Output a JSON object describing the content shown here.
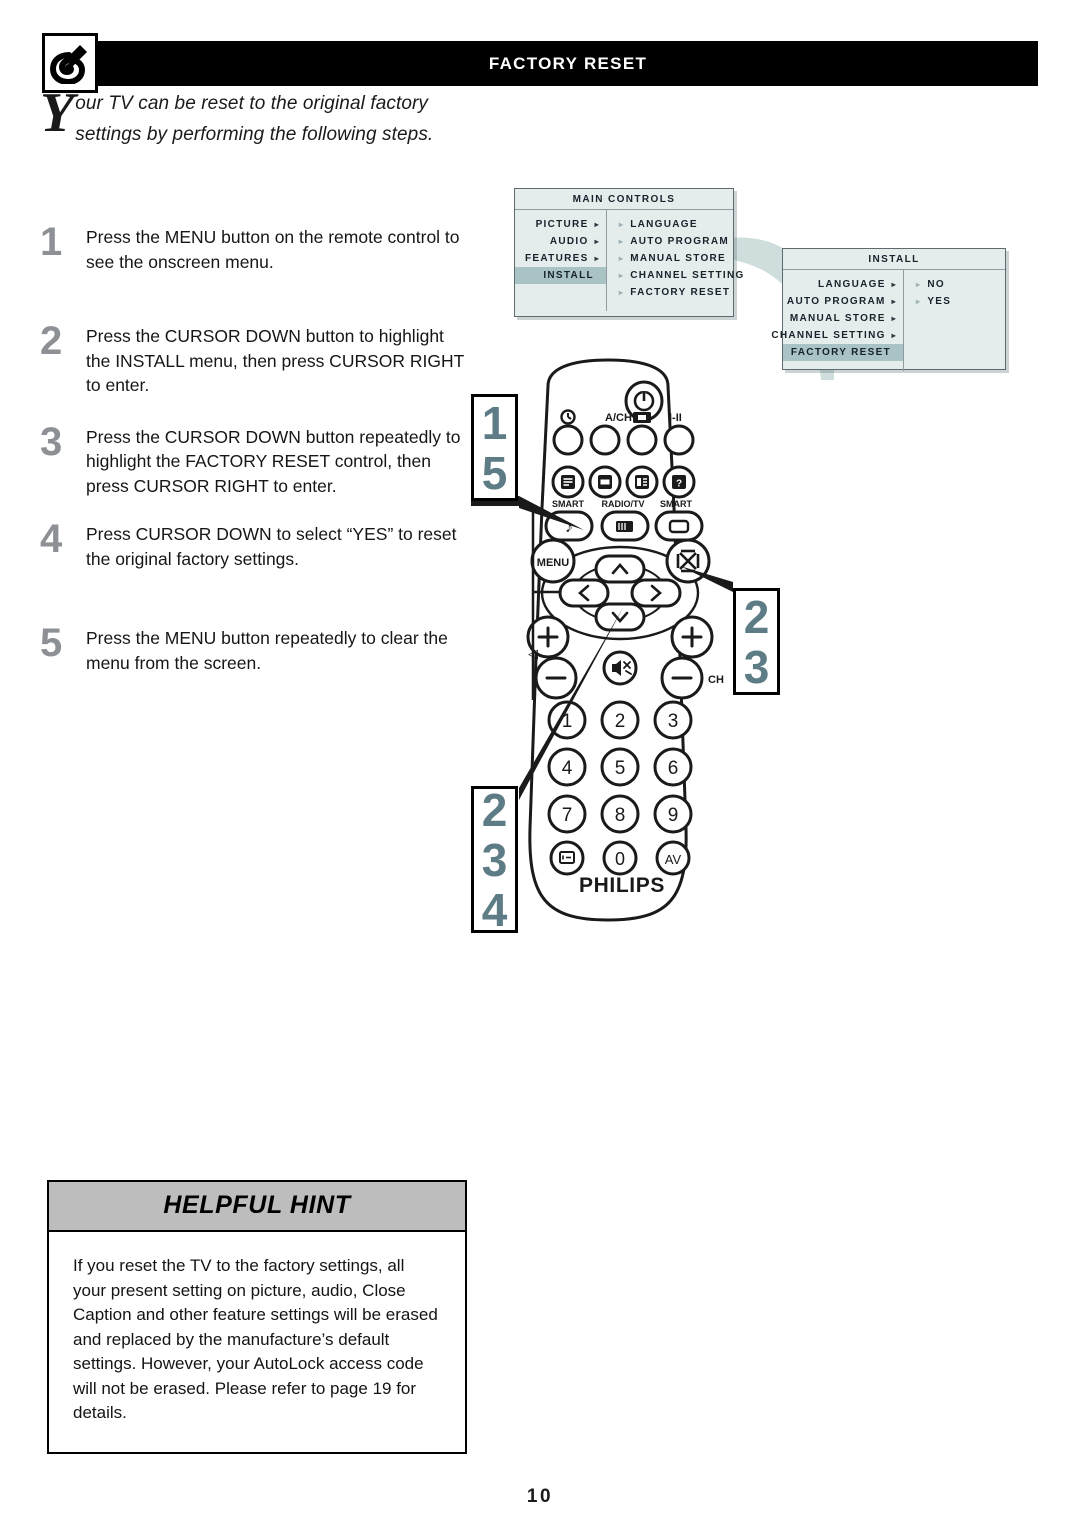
{
  "header": {
    "title": "FACTORY RESET",
    "logo_icon": "philips-shield-logo-icon"
  },
  "intro": {
    "dropcap": "Y",
    "text": "our TV can be reset to the original factory settings by performing the following steps."
  },
  "steps": [
    {
      "number": "1",
      "text": "Press the MENU button on the remote control to see the onscreen menu."
    },
    {
      "number": "2",
      "text": "Press the CURSOR DOWN button to highlight the INSTALL menu, then press CURSOR RIGHT to enter."
    },
    {
      "number": "3",
      "text": "Press the CURSOR DOWN button repeatedly to highlight the FACTORY RESET control, then press CURSOR RIGHT to enter."
    },
    {
      "number": "4",
      "text": "Press CURSOR DOWN to select “YES” to reset the original factory settings."
    },
    {
      "number": "5",
      "text": "Press the MENU button repeatedly to clear the menu from the screen."
    }
  ],
  "osd_main": {
    "title": "MAIN CONTROLS",
    "left_items": [
      {
        "label": "PICTURE",
        "arrow": "▸",
        "selected": false
      },
      {
        "label": "AUDIO",
        "arrow": "▸",
        "selected": false
      },
      {
        "label": "FEATURES",
        "arrow": "▸",
        "selected": false
      },
      {
        "label": "INSTALL",
        "arrow": "",
        "selected": true
      }
    ],
    "right_items": [
      {
        "label": "LANGUAGE",
        "bullet": "▸"
      },
      {
        "label": "AUTO PROGRAM",
        "bullet": "▸"
      },
      {
        "label": "MANUAL STORE",
        "bullet": "▸"
      },
      {
        "label": "CHANNEL SETTING",
        "bullet": "▸"
      },
      {
        "label": "FACTORY RESET",
        "bullet": "▸"
      }
    ]
  },
  "osd_install": {
    "title": "INSTALL",
    "left_items": [
      {
        "label": "LANGUAGE",
        "arrow": "▸",
        "selected": false
      },
      {
        "label": "AUTO PROGRAM",
        "arrow": "▸",
        "selected": false
      },
      {
        "label": "MANUAL STORE",
        "arrow": "▸",
        "selected": false
      },
      {
        "label": "CHANNEL SETTING",
        "arrow": "▸",
        "selected": false
      },
      {
        "label": "FACTORY RESET",
        "arrow": "",
        "selected": true
      }
    ],
    "right_items": [
      {
        "label": "NO",
        "bullet": "▸"
      },
      {
        "label": "YES",
        "bullet": "▸"
      }
    ]
  },
  "callouts": {
    "left_top": [
      "1",
      "5"
    ],
    "right_middle": [
      "2",
      "3"
    ],
    "left_bottom": [
      "2",
      "3",
      "4"
    ]
  },
  "remote": {
    "brand": "PHILIPS",
    "row1_labels": [
      "",
      "A/CH",
      "",
      "I-II"
    ],
    "row1_icons": [
      "sleep-timer-icon",
      "alternate-channel-icon",
      "picture-format-icon",
      "sound-mode-icon"
    ],
    "power_icon": "power-icon",
    "row2_icons": [
      "text-icon",
      "text-mix-icon",
      "text-index-icon",
      "text-reveal-icon"
    ],
    "row3_labels": [
      "SMART",
      "RADIO/TV",
      "SMART"
    ],
    "row3_icons": [
      "smart-sound-icon",
      "radio-tv-icon",
      "smart-picture-icon"
    ],
    "menu_label": "MENU",
    "surf_icon": "surf-icon",
    "cursor_up_icon": "cursor-up-icon",
    "cursor_down_icon": "cursor-down-icon",
    "cursor_left_icon": "cursor-left-icon",
    "cursor_right_icon": "cursor-right-icon",
    "volume_label": "◁",
    "channel_label": "CH",
    "mute_icon": "mute-icon",
    "volume_plus": "+",
    "volume_minus": "−",
    "channel_plus": "+",
    "channel_minus": "−",
    "keypad": [
      "1",
      "2",
      "3",
      "4",
      "5",
      "6",
      "7",
      "8",
      "9",
      "status-icon",
      "0",
      "AV"
    ]
  },
  "hint": {
    "title": "HELPFUL HINT",
    "text": "If you reset the TV to the factory settings, all your present setting on picture, audio, Close Caption and other feature settings will be erased and replaced by the manufacture’s default settings. However, your AutoLock access code will not be erased. Please refer to page 19 for details."
  },
  "page_number": "10",
  "colors": {
    "accent_teal": "#5e7c85",
    "osd_bg": "#e4ecec",
    "osd_highlight": "#a9c2c4",
    "step_number": "#8d9195",
    "hint_header": "#bdbdbd"
  }
}
